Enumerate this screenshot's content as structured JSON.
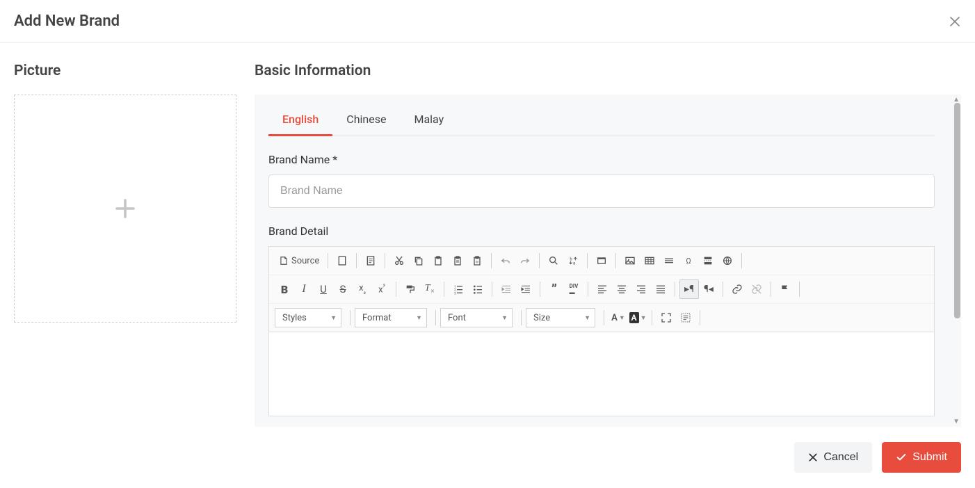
{
  "header": {
    "title": "Add New Brand"
  },
  "left": {
    "heading": "Picture"
  },
  "right": {
    "heading": "Basic Information",
    "tabs": [
      {
        "id": "english",
        "label": "English",
        "active": true
      },
      {
        "id": "chinese",
        "label": "Chinese",
        "active": false
      },
      {
        "id": "malay",
        "label": "Malay",
        "active": false
      }
    ],
    "brand_name": {
      "label": "Brand Name *",
      "placeholder": "Brand Name",
      "value": ""
    },
    "brand_detail": {
      "label": "Brand Detail"
    },
    "editor": {
      "source_label": "Source",
      "selects": {
        "styles": "Styles",
        "format": "Format",
        "font": "Font",
        "size": "Size"
      }
    }
  },
  "footer": {
    "cancel": "Cancel",
    "submit": "Submit"
  }
}
